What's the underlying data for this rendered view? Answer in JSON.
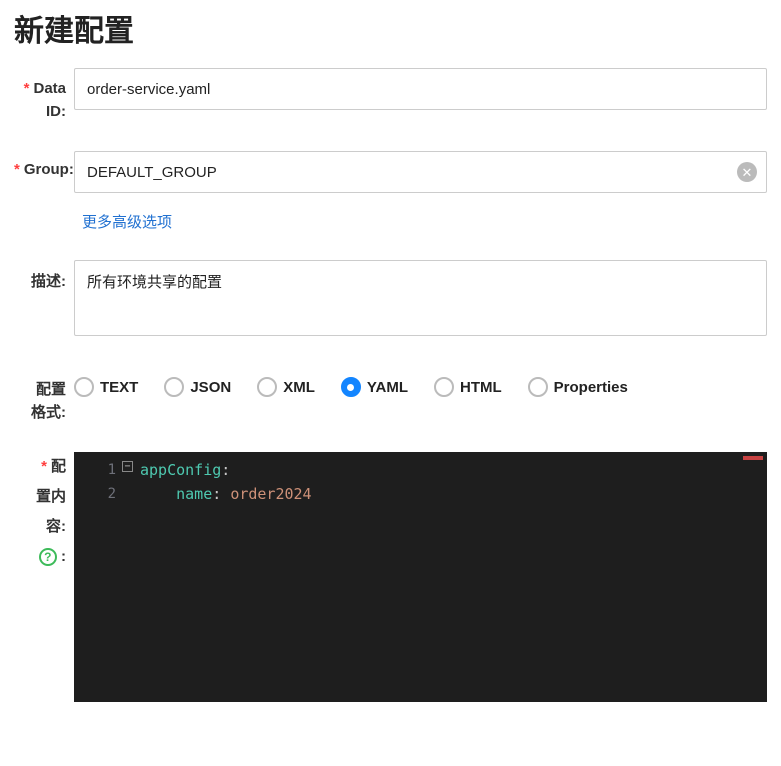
{
  "page": {
    "title": "新建配置"
  },
  "form": {
    "dataId": {
      "label_line1": "Data",
      "label_line2": "ID:",
      "value": "order-service.yaml"
    },
    "group": {
      "label": "Group:",
      "value": "DEFAULT_GROUP"
    },
    "advanced_link": "更多高级选项",
    "description": {
      "label": "描述:",
      "value": "所有环境共享的配置"
    },
    "format": {
      "label_line1": "配置",
      "label_line2": "格式:",
      "options": [
        "TEXT",
        "JSON",
        "XML",
        "YAML",
        "HTML",
        "Properties"
      ],
      "selected": "YAML"
    },
    "content": {
      "label_line1": "配",
      "label_line2": "置内",
      "label_line3": "容:",
      "code": {
        "line1_key": "appConfig",
        "line2_key": "name",
        "line2_value": "order2024"
      }
    }
  }
}
